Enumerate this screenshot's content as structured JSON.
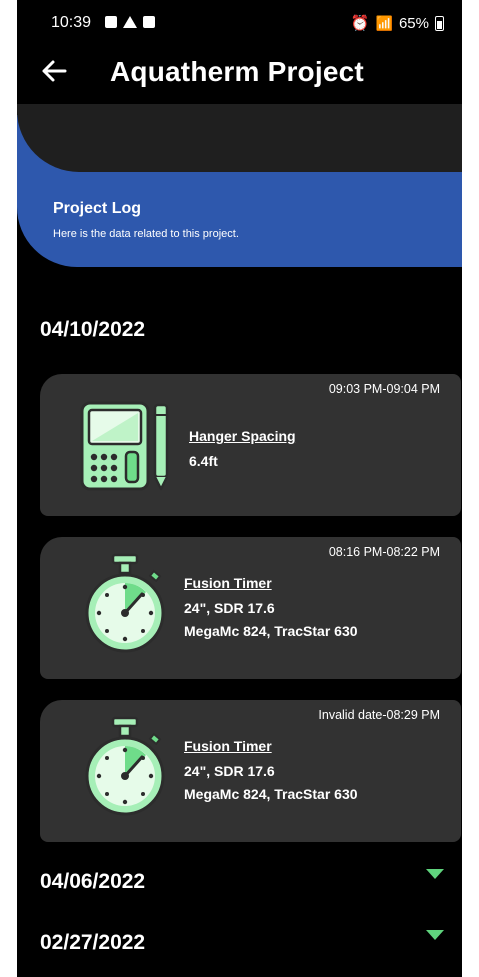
{
  "status": {
    "time": "10:39",
    "battery": "65%"
  },
  "header": {
    "title": "Aquatherm Project",
    "back_icon": "arrow-left-icon"
  },
  "banner": {
    "title": "Project Log",
    "subtitle": "Here is the data related to this project."
  },
  "groups": [
    {
      "date": "04/10/2022",
      "expanded": true,
      "entries": [
        {
          "time_range": "09:03 PM-09:04 PM",
          "tool": "Hanger Spacing",
          "line1": "6.4ft",
          "line2": "",
          "icon": "calculator-icon"
        },
        {
          "time_range": "08:16 PM-08:22 PM",
          "tool": "Fusion Timer",
          "line1": "24\", SDR 17.6",
          "line2": "MegaMc 824, TracStar 630",
          "icon": "stopwatch-icon"
        },
        {
          "time_range": "Invalid date-08:29 PM",
          "tool": "Fusion Timer",
          "line1": "24\", SDR 17.6",
          "line2": "MegaMc 824, TracStar 630",
          "icon": "stopwatch-icon"
        }
      ]
    },
    {
      "date": "04/06/2022",
      "expanded": false
    },
    {
      "date": "02/27/2022",
      "expanded": false
    }
  ],
  "colors": {
    "accent": "#5fd37d",
    "banner": "#2e58ad",
    "card": "#323232"
  }
}
